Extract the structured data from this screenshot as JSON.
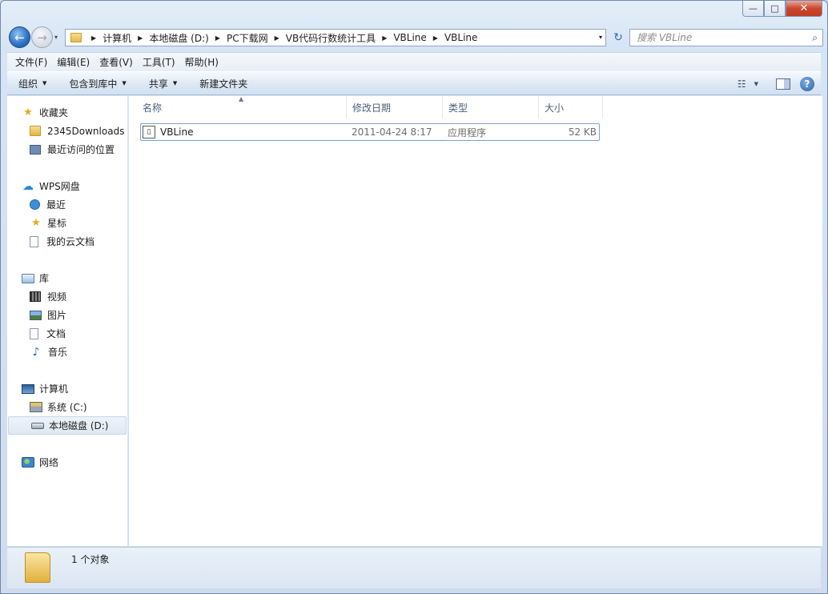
{
  "window": {
    "controls": {
      "minimize": "—",
      "maximize": "□",
      "close": "✕"
    }
  },
  "nav": {
    "back_icon": "←",
    "forward_icon": "→",
    "history_icon": "▾",
    "breadcrumb": [
      "计算机",
      "本地磁盘 (D:)",
      "PC下载网",
      "VB代码行数统计工具",
      "VBLine",
      "VBLine"
    ],
    "address_dropdown": "▾",
    "refresh_icon": "↻",
    "search_placeholder": "搜索 VBLine",
    "search_icon": "⌕"
  },
  "menubar": [
    "文件(F)",
    "编辑(E)",
    "查看(V)",
    "工具(T)",
    "帮助(H)"
  ],
  "commandbar": {
    "organize": "组织",
    "include_in_library": "包含到库中",
    "share": "共享",
    "new_folder": "新建文件夹",
    "view_icon": "☷",
    "help_icon": "?"
  },
  "sidebar": {
    "favorites": {
      "label": "收藏夹",
      "items": [
        "2345Downloads",
        "最近访问的位置"
      ]
    },
    "wps": {
      "label": "WPS网盘",
      "items": [
        "最近",
        "星标",
        "我的云文档"
      ]
    },
    "libraries": {
      "label": "库",
      "items": [
        "视频",
        "图片",
        "文档",
        "音乐"
      ]
    },
    "computer": {
      "label": "计算机",
      "items": [
        "系统 (C:)",
        "本地磁盘 (D:)"
      ]
    },
    "network": {
      "label": "网络"
    }
  },
  "columns": {
    "name": "名称",
    "modified": "修改日期",
    "type": "类型",
    "size": "大小"
  },
  "files": [
    {
      "name": "VBLine",
      "modified": "2011-04-24 8:17",
      "type": "应用程序",
      "size": "52 KB"
    }
  ],
  "status": {
    "text": "1 个对象"
  }
}
